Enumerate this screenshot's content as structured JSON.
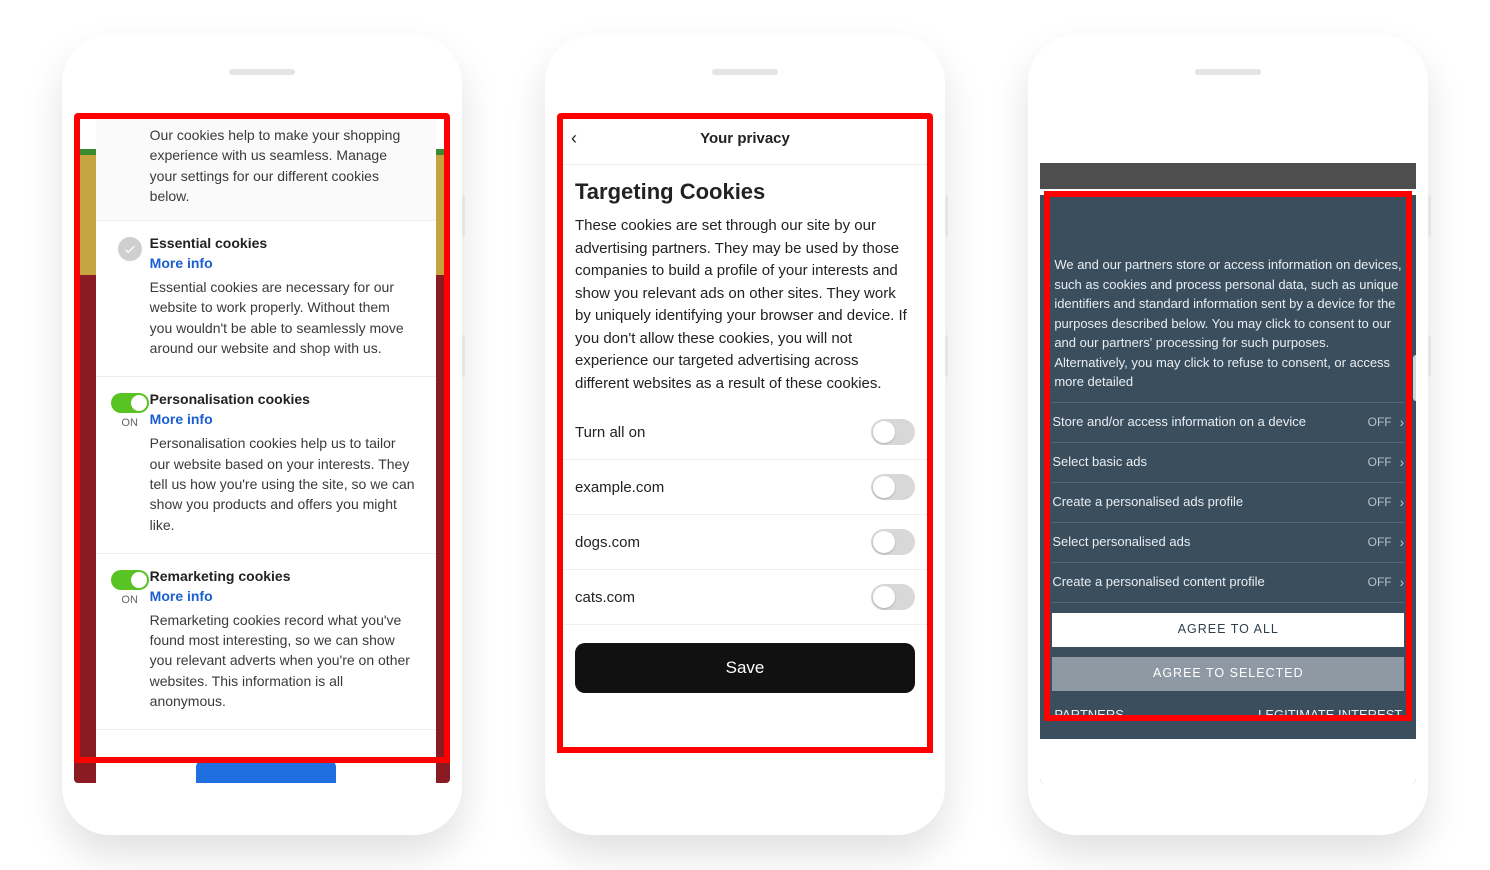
{
  "phone1": {
    "intro": "Our cookies help to make your shopping experience with us seamless. Manage your settings for our different cookies below.",
    "more_info": "More info",
    "on_label": "ON",
    "sections": [
      {
        "title": "Essential cookies",
        "desc": "Essential cookies are necessary for our website to work properly. Without them you wouldn't be able to seamlessly move around our website and shop with us."
      },
      {
        "title": "Personalisation cookies",
        "desc": "Personalisation cookies help us to tailor our website based on your interests. They tell us how you're using the site, so we can show you products and offers you might like."
      },
      {
        "title": "Remarketing cookies",
        "desc": "Remarketing cookies record what you've found most interesting, so we can show you relevant adverts when you're on other websites. This information is all anonymous."
      }
    ]
  },
  "phone2": {
    "header_title": "Your privacy",
    "heading": "Targeting Cookies",
    "desc": "These cookies are set through our site by our advertising partners. They may be used by those companies to build a profile of your interests and show you relevant ads on other sites. They work by uniquely identifying your browser and device. If you don't allow these cookies, you will not experience our targeted advertising across different websites as a result of these cookies.",
    "rows": [
      "Turn all on",
      "example.com",
      "dogs.com",
      "cats.com"
    ],
    "save": "Save"
  },
  "phone3": {
    "intro": "We and our partners store or access information on devices, such as cookies and process personal data, such as unique identifiers and standard information sent by a device for the purposes described below. You may click to consent to our and our partners' processing for such purposes. Alternatively, you may click to refuse to consent, or access more detailed",
    "off": "OFF",
    "rows": [
      "Store and/or access information on a device",
      "Select basic ads",
      "Create a personalised ads profile",
      "Select personalised ads",
      "Create a personalised content profile"
    ],
    "agree_all": "AGREE TO ALL",
    "agree_selected": "AGREE TO SELECTED",
    "partners": "PARTNERS",
    "legit": "LEGITIMATE INTEREST"
  }
}
